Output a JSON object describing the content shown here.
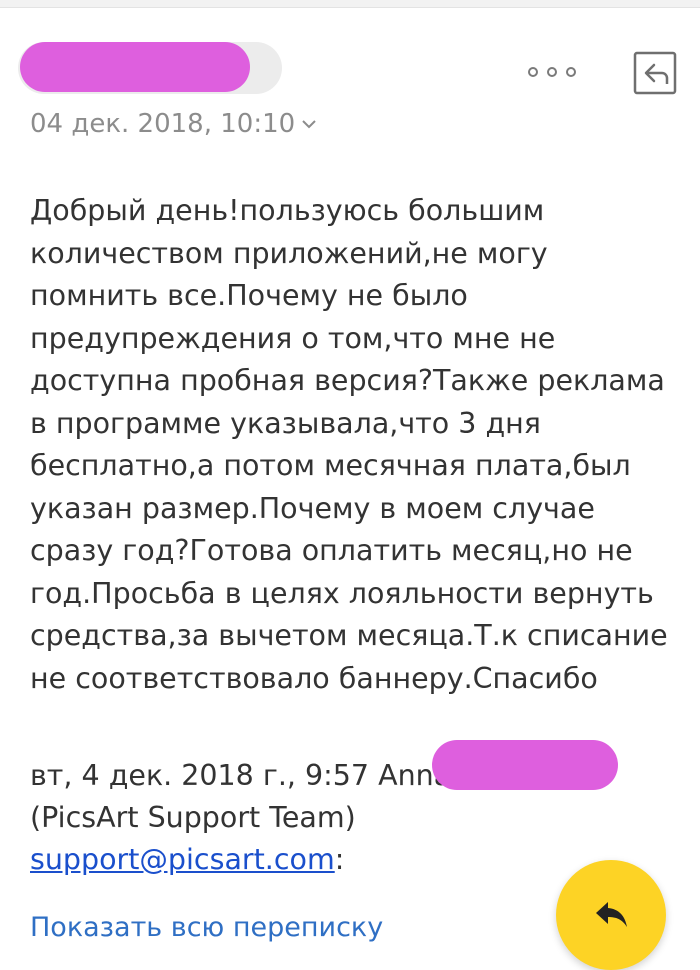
{
  "header": {
    "date": "04 дек. 2018, 10:10",
    "more_icon": "more-options-icon",
    "back_icon": "back-to-list-icon",
    "date_toggle_icon": "chevron-down-icon"
  },
  "message": {
    "body": "Добрый день!пользуюсь большим\nколичеством приложений,не могу\nпомнить все.Почему не было\nпредупреждения о том,что мне не\nдоступна пробная версия?Также реклама\nв программе указывала,что 3 дня\nбесплатно,а потом месячная плата,был\nуказан размер.Почему в моем случае\nсразу год?Готова оплатить месяц,но не\nгод.Просьба в целях лояльности вернуть\nсредства,за вычетом месяца.Т.к списание\nне соответствовало баннеру.Спасибо"
  },
  "quote": {
    "header_line1": "вт, 4 дек. 2018 г., 9:57 Anna",
    "header_line2": "(PicsArt Support Team)",
    "email": "support@picsart.com",
    "email_suffix": ":"
  },
  "actions": {
    "show_all": "Показать всю переписку",
    "reply_icon": "reply-icon"
  },
  "colors": {
    "redaction": "#de5fde",
    "fab": "#fdd325",
    "link": "#2f6fc4"
  }
}
